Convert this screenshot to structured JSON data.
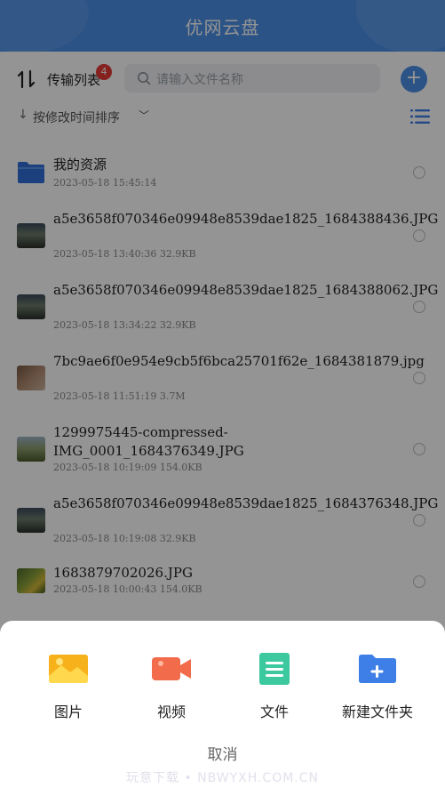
{
  "header": {
    "title": "优网云盘"
  },
  "toolbar": {
    "transfer_label": "传输列表",
    "transfer_badge": "4",
    "search_placeholder": "请输入文件名称"
  },
  "sortbar": {
    "sort_label": "按修改时间排序"
  },
  "files": [
    {
      "name": "我的资源",
      "meta": "2023-05-18 15:45:14",
      "type": "folder"
    },
    {
      "name": "a5e3658f070346e09948e8539dae1825_1684388436.JPG",
      "meta": "2023-05-18 13:40:36  32.9KB",
      "type": "image"
    },
    {
      "name": "a5e3658f070346e09948e8539dae1825_1684388062.JPG",
      "meta": "2023-05-18 13:34:22  32.9KB",
      "type": "image"
    },
    {
      "name": "7bc9ae6f0e954e9cb5f6bca25701f62e_1684381879.jpg",
      "meta": "2023-05-18 11:51:19  3.7M",
      "type": "image"
    },
    {
      "name": "1299975445-compressed-IMG_0001_1684376349.JPG",
      "meta": "2023-05-18 10:19:09  154.0KB",
      "type": "image"
    },
    {
      "name": "a5e3658f070346e09948e8539dae1825_1684376348.JPG",
      "meta": "2023-05-18 10:19:08  32.9KB",
      "type": "image"
    },
    {
      "name": "1683879702026.JPG",
      "meta": "2023-05-18 10:00:43  154.0KB",
      "type": "image"
    }
  ],
  "sheet": {
    "actions": [
      {
        "label": "图片",
        "icon": "image-icon",
        "color": "#f5a623"
      },
      {
        "label": "视频",
        "icon": "video-icon",
        "color": "#f26b4a"
      },
      {
        "label": "文件",
        "icon": "document-icon",
        "color": "#3cc9a0"
      },
      {
        "label": "新建文件夹",
        "icon": "new-folder-icon",
        "color": "#3d7fe6"
      }
    ],
    "cancel_label": "取消",
    "watermark": "玩意下载 • NBWYXH.COM.CN"
  },
  "colors": {
    "accent": "#4a8fe6",
    "badge": "#e53935"
  }
}
